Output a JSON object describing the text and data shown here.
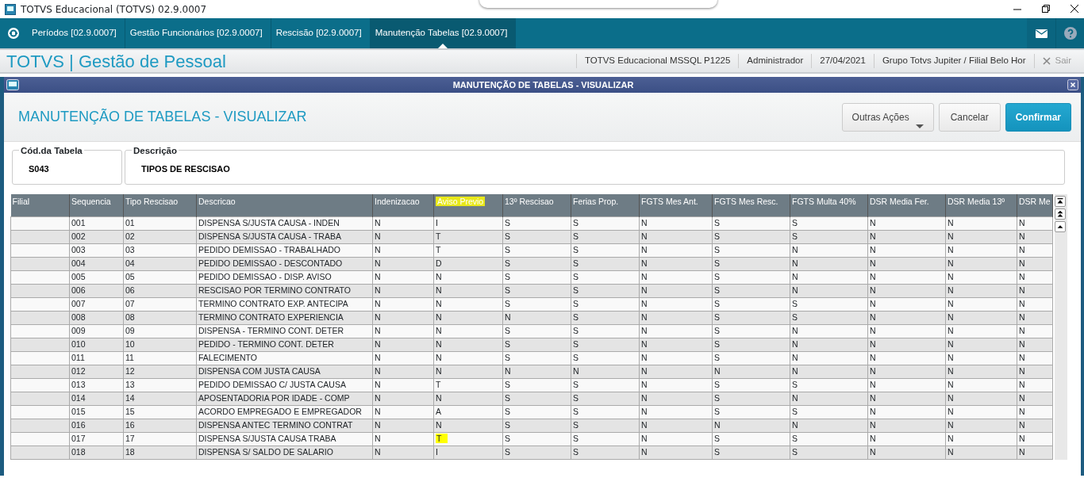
{
  "window": {
    "title": "TOTVS Educacional (TOTVS) 02.9.0007"
  },
  "tabs": [
    {
      "label": "Períodos [02.9.0007]",
      "selected": false
    },
    {
      "label": "Gestão Funcionários [02.9.0007]",
      "selected": false
    },
    {
      "label": "Rescisão [02.9.0007]",
      "selected": false
    },
    {
      "label": "Manutenção Tabelas [02.9.0007]",
      "selected": true
    }
  ],
  "app_header": {
    "title": "TOTVS | Gestão de Pessoal",
    "info": [
      "TOTVS Educacional MSSQL P1225",
      "Administrador",
      "27/04/2021",
      "Grupo Totvs Jupiter / Filial Belo Hor"
    ],
    "logout": "Sair"
  },
  "dialog": {
    "title": "MANUTENÇÃO DE TABELAS - VISUALIZAR",
    "heading": "MANUTENÇÃO DE TABELAS - VISUALIZAR",
    "buttons": [
      {
        "label": "Outras Ações",
        "kind": "dropdown"
      },
      {
        "label": "Cancelar",
        "kind": "default"
      },
      {
        "label": "Confirmar",
        "kind": "primary"
      }
    ],
    "fields": [
      {
        "label": "Cód.da Tabela",
        "value": "S043"
      },
      {
        "label": "Descrição",
        "value": "TIPOS DE RESCISAO"
      }
    ]
  },
  "table": {
    "columns": [
      {
        "label": "Filial",
        "highlighted": false
      },
      {
        "label": "Sequencia",
        "highlighted": false
      },
      {
        "label": "Tipo Rescisao",
        "highlighted": false
      },
      {
        "label": "Descricao",
        "highlighted": false
      },
      {
        "label": "Indenizacao",
        "highlighted": false
      },
      {
        "label": "Aviso Previo",
        "highlighted": true
      },
      {
        "label": "13º Rescisao",
        "highlighted": false
      },
      {
        "label": "Ferias Prop.",
        "highlighted": false
      },
      {
        "label": "FGTS Mes Ant.",
        "highlighted": false
      },
      {
        "label": "FGTS Mes Resc.",
        "highlighted": false
      },
      {
        "label": "FGTS Multa 40%",
        "highlighted": false
      },
      {
        "label": "DSR Media Fer.",
        "highlighted": false
      },
      {
        "label": "DSR Media 13º",
        "highlighted": false
      },
      {
        "label": "DSR Me",
        "highlighted": false
      }
    ],
    "rows": [
      {
        "highlighted": false,
        "cells": [
          "",
          "001",
          "01",
          "DISPENSA S/JUSTA CAUSA - INDEN",
          "N",
          "I",
          "S",
          "S",
          "N",
          "S",
          "S",
          "N",
          "N",
          "N"
        ]
      },
      {
        "highlighted": false,
        "cells": [
          "",
          "002",
          "02",
          "DISPENSA S/JUSTA CAUSA - TRABA",
          "N",
          "T",
          "S",
          "S",
          "N",
          "S",
          "S",
          "N",
          "N",
          "N"
        ]
      },
      {
        "highlighted": false,
        "cells": [
          "",
          "003",
          "03",
          "PEDIDO DEMISSAO - TRABALHADO",
          "N",
          "T",
          "S",
          "S",
          "N",
          "S",
          "N",
          "N",
          "N",
          "N"
        ]
      },
      {
        "highlighted": false,
        "cells": [
          "",
          "004",
          "04",
          "PEDIDO DEMISSAO - DESCONTADO",
          "N",
          "D",
          "S",
          "S",
          "N",
          "S",
          "N",
          "N",
          "N",
          "N"
        ]
      },
      {
        "highlighted": false,
        "cells": [
          "",
          "005",
          "05",
          "PEDIDO DEMISSAO - DISP. AVISO",
          "N",
          "N",
          "S",
          "S",
          "N",
          "S",
          "N",
          "N",
          "N",
          "N"
        ]
      },
      {
        "highlighted": false,
        "cells": [
          "",
          "006",
          "06",
          "RESCISAO POR TERMINO CONTRATO",
          "N",
          "N",
          "S",
          "S",
          "N",
          "S",
          "N",
          "N",
          "N",
          "N"
        ]
      },
      {
        "highlighted": false,
        "cells": [
          "",
          "007",
          "07",
          "TERMINO CONTRATO EXP. ANTECIPA",
          "N",
          "N",
          "S",
          "S",
          "N",
          "S",
          "S",
          "N",
          "N",
          "N"
        ]
      },
      {
        "highlighted": false,
        "cells": [
          "",
          "008",
          "08",
          "TERMINO CONTRATO EXPERIENCIA",
          "N",
          "N",
          "N",
          "S",
          "N",
          "S",
          "S",
          "N",
          "N",
          "N"
        ]
      },
      {
        "highlighted": false,
        "cells": [
          "",
          "009",
          "09",
          "DISPENSA - TERMINO CONT. DETER",
          "N",
          "N",
          "S",
          "S",
          "N",
          "S",
          "N",
          "N",
          "N",
          "N"
        ]
      },
      {
        "highlighted": false,
        "cells": [
          "",
          "010",
          "10",
          "PEDIDO - TERMINO CONT. DETER",
          "N",
          "N",
          "S",
          "S",
          "N",
          "S",
          "N",
          "N",
          "N",
          "N"
        ]
      },
      {
        "highlighted": false,
        "cells": [
          "",
          "011",
          "11",
          "FALECIMENTO",
          "N",
          "N",
          "S",
          "S",
          "N",
          "S",
          "N",
          "N",
          "N",
          "N"
        ]
      },
      {
        "highlighted": false,
        "cells": [
          "",
          "012",
          "12",
          "DISPENSA COM JUSTA CAUSA",
          "N",
          "N",
          "N",
          "N",
          "N",
          "N",
          "N",
          "N",
          "N",
          "N"
        ]
      },
      {
        "highlighted": false,
        "cells": [
          "",
          "013",
          "13",
          "PEDIDO DEMISSAO C/ JUSTA CAUSA",
          "N",
          "T",
          "S",
          "S",
          "N",
          "S",
          "S",
          "N",
          "N",
          "N"
        ]
      },
      {
        "highlighted": false,
        "cells": [
          "",
          "014",
          "14",
          "APOSENTADORIA POR IDADE - COMP",
          "N",
          "N",
          "S",
          "S",
          "N",
          "S",
          "N",
          "N",
          "N",
          "N"
        ]
      },
      {
        "highlighted": false,
        "cells": [
          "",
          "015",
          "15",
          "ACORDO EMPREGADO E EMPREGADOR",
          "N",
          "A",
          "S",
          "S",
          "N",
          "S",
          "S",
          "N",
          "N",
          "N"
        ]
      },
      {
        "highlighted": false,
        "cells": [
          "",
          "016",
          "16",
          "DISPENSA ANTEC TERMINO CONTRAT",
          "N",
          "N",
          "S",
          "S",
          "N",
          "N",
          "N",
          "N",
          "N",
          "N"
        ]
      },
      {
        "highlighted": true,
        "cells": [
          "",
          "017",
          "17",
          "DISPENSA S/JUSTA CAUSA TRABA",
          "N",
          "T",
          "S",
          "S",
          "N",
          "S",
          "S",
          "N",
          "N",
          "N"
        ]
      },
      {
        "highlighted": false,
        "cells": [
          "",
          "018",
          "18",
          "DISPENSA S/ SALDO DE SALARIO",
          "N",
          "I",
          "S",
          "S",
          "N",
          "S",
          "S",
          "N",
          "N",
          "N"
        ]
      }
    ]
  }
}
